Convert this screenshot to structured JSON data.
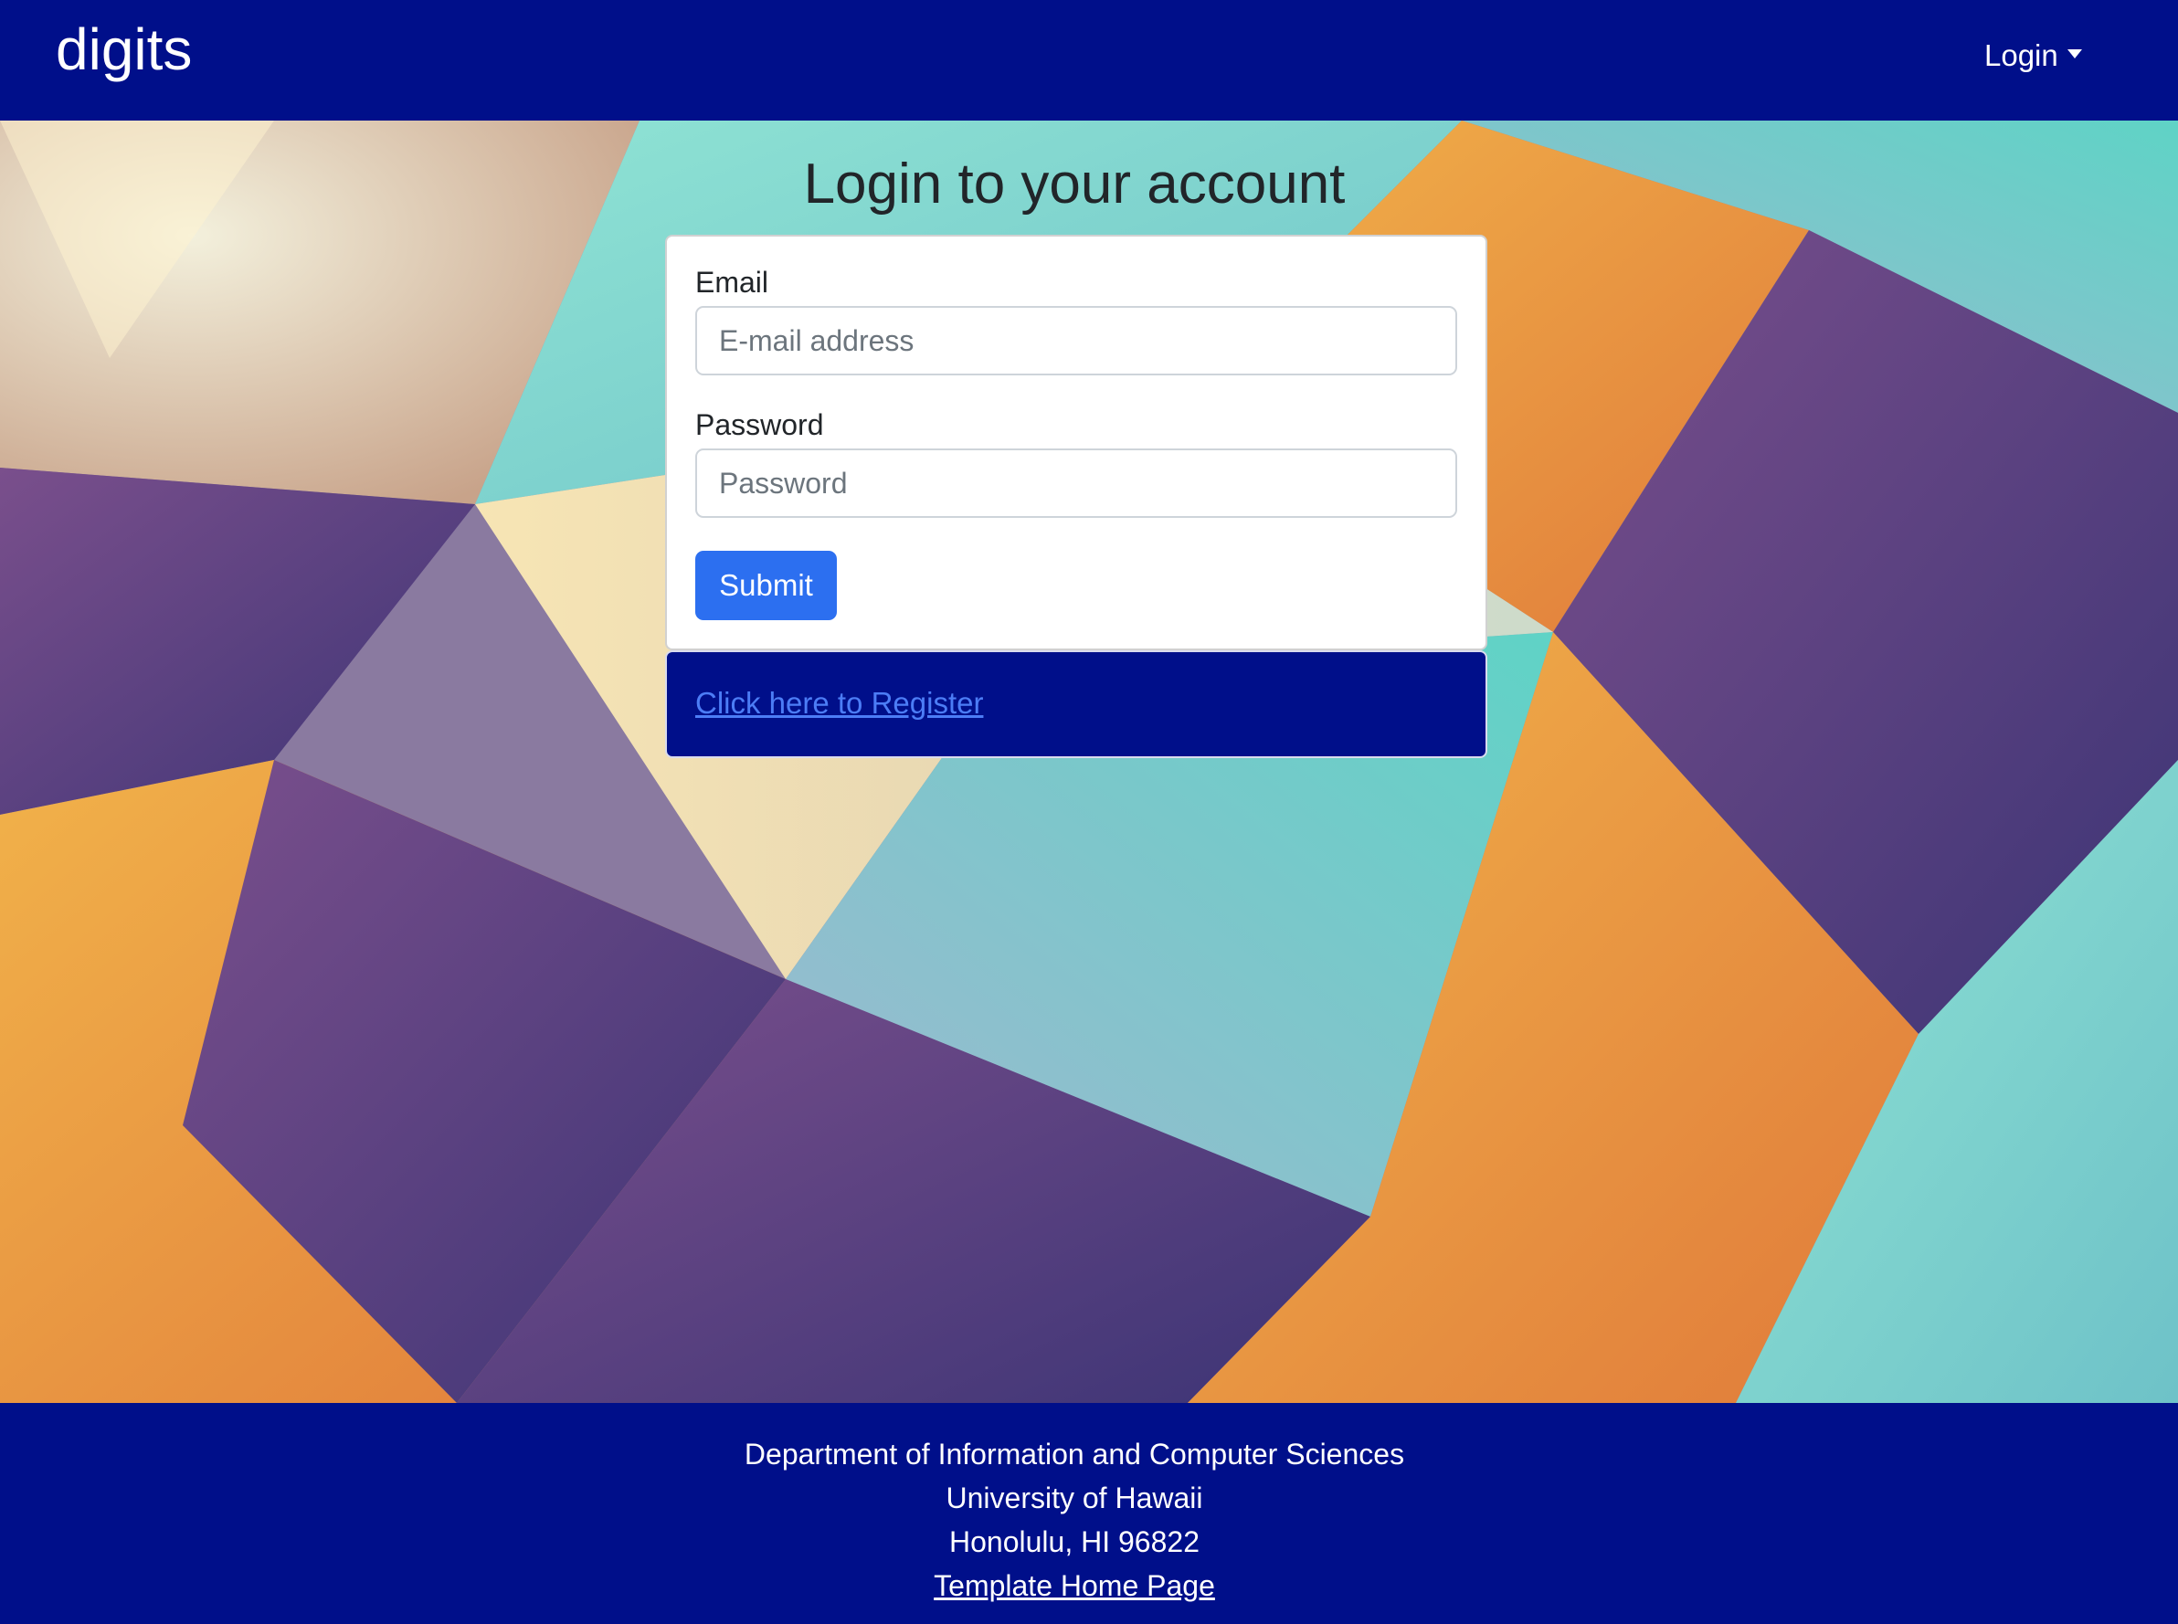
{
  "navbar": {
    "brand": "digits",
    "login_label": "Login"
  },
  "main": {
    "title": "Login to your account"
  },
  "login_form": {
    "email_label": "Email",
    "email_placeholder": "E-mail address",
    "email_value": "",
    "password_label": "Password",
    "password_placeholder": "Password",
    "password_value": "",
    "submit_label": "Submit"
  },
  "register": {
    "link_text": "Click here to Register"
  },
  "footer": {
    "line1": "Department of Information and Computer Sciences",
    "line2": "University of Hawaii",
    "line3": "Honolulu, HI 96822",
    "link_text": "Template Home Page"
  },
  "colors": {
    "brand_navy": "#000f8a",
    "primary_button": "#2c6ff0",
    "link": "#4c7df6"
  },
  "icons": {
    "login_dropdown": "caret-down-icon"
  }
}
